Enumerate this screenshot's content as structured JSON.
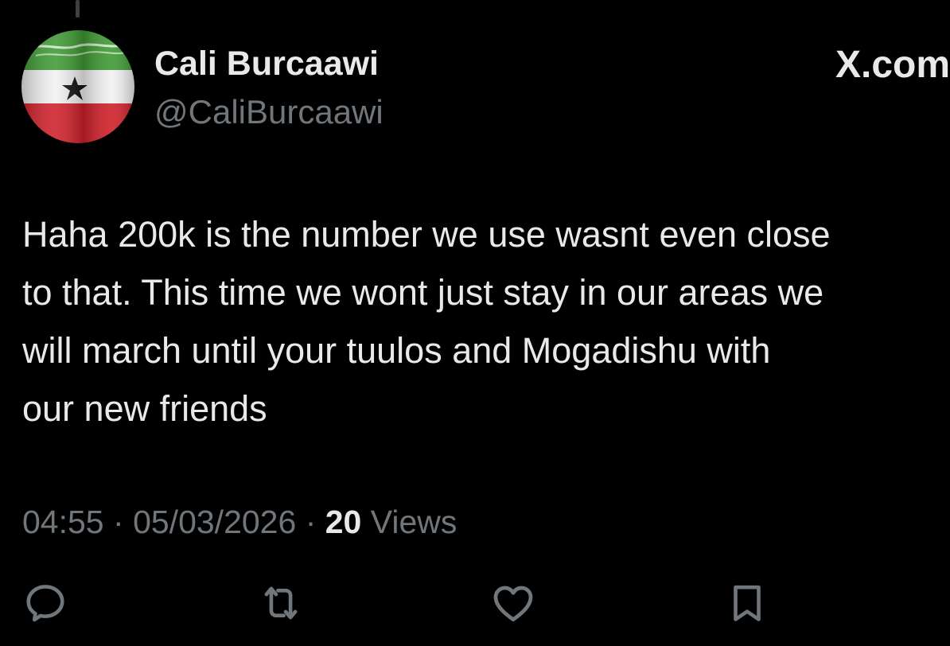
{
  "app": "X",
  "post": {
    "author": {
      "display_name": "Cali Burcaawi",
      "handle": "@CaliBurcaawi",
      "avatar_icon": "flag-avatar"
    },
    "brand_text": "X.com",
    "text_lines": [
      "Haha 200k is the number we use wasnt even close",
      "to that. This time we wont just stay in our areas we",
      "will march until your tuulos and Mogadishu with",
      "our new friends"
    ],
    "time": "04:55",
    "separator": "·",
    "date": "05/03/2026",
    "views_count": "20",
    "views_label": "Views"
  },
  "actions": [
    {
      "name": "reply",
      "icon": "reply-icon"
    },
    {
      "name": "repost",
      "icon": "repost-icon"
    },
    {
      "name": "like",
      "icon": "like-icon"
    },
    {
      "name": "bookmark",
      "icon": "bookmark-icon"
    }
  ],
  "colors": {
    "background": "#000000",
    "primary_text": "#e7e9ea",
    "secondary_text": "#71767b",
    "flag_green": "#3f9a35",
    "flag_white": "#f2f2f2",
    "flag_red": "#d0202a"
  }
}
